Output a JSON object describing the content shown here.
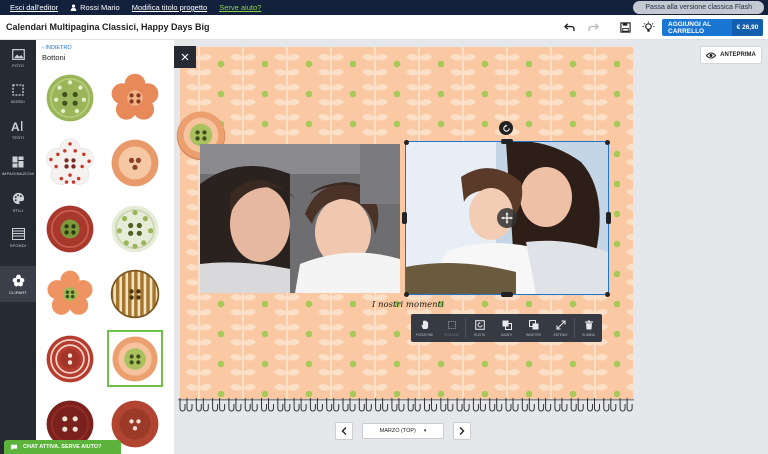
{
  "topnav": {
    "exit_editor": "Esci dall'editor",
    "user_name": "Rossi Mario",
    "edit_title": "Modifica titolo progetto",
    "help": "Serve aiuto?",
    "flash_button": "Passa alla versione classica Flash"
  },
  "header": {
    "project_title": "Calendari Multipagina Classici, Happy Days Big",
    "cart_label": "AGGIUNGI AL CARRELLO",
    "cart_price": "€ 26,90"
  },
  "toolbar": {
    "items": [
      {
        "label": "FOTO",
        "icon": "photo-icon"
      },
      {
        "label": "BORDI",
        "icon": "border-icon"
      },
      {
        "label": "TESTI",
        "icon": "text-icon"
      },
      {
        "label": "IMPAGINAZIONI",
        "icon": "layout-icon"
      },
      {
        "label": "STILI",
        "icon": "palette-icon"
      },
      {
        "label": "SFONDI",
        "icon": "background-icon"
      },
      {
        "label": "CLIPART",
        "icon": "clipart-icon"
      }
    ]
  },
  "panel": {
    "back": "INDIETRO",
    "title": "Bottoni"
  },
  "canvas": {
    "preview": "ANTEPRIMA",
    "caption": "I nostri momenti",
    "context_menu": [
      {
        "label": "POSIZIONE",
        "icon": "hand-icon"
      },
      {
        "label": "RITAGLIA",
        "icon": "crop-icon"
      },
      {
        "label": "RUOTA",
        "icon": "rotate-icon"
      },
      {
        "label": "AVANTI",
        "icon": "bring-forward-icon"
      },
      {
        "label": "INDIETRO",
        "icon": "send-backward-icon"
      },
      {
        "label": "ESTENDI",
        "icon": "expand-icon"
      },
      {
        "label": "ELIMINA",
        "icon": "trash-icon"
      }
    ]
  },
  "month_nav": {
    "selected": "MARZO (TOP)"
  },
  "chat": {
    "label": "CHAT ATTIVA. SERVE AIUTO?"
  },
  "colors": {
    "nav_bg": "#14213d",
    "accent": "#1976d2",
    "page_bg": "#fac9a3",
    "leaf": "#fbe0c7",
    "dot": "#a8c85a",
    "chat": "#5bb33c"
  }
}
